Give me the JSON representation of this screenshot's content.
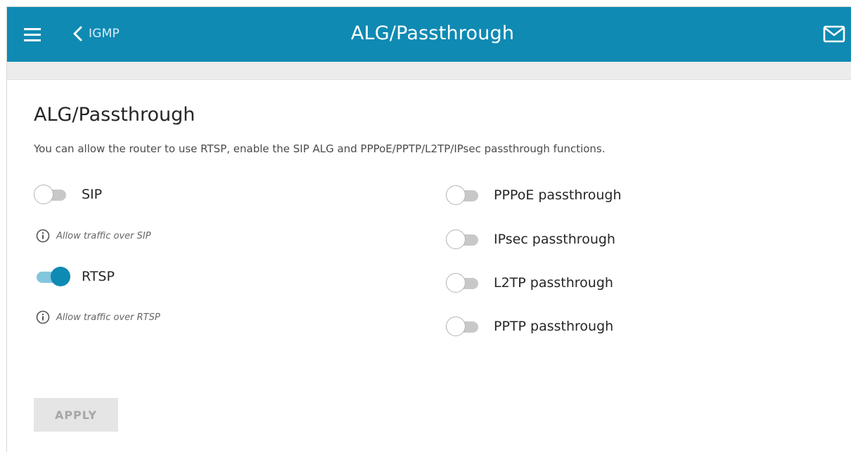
{
  "header": {
    "back_label": "IGMP",
    "title": "ALG/Passthrough",
    "menu_icon": "hamburger-menu-icon",
    "back_icon": "chevron-left-icon",
    "mail_icon": "envelope-icon",
    "background_color": "#0f8ab3"
  },
  "section": {
    "title": "ALG/Passthrough",
    "description": "You can allow the router to use RTSP, enable the SIP ALG and PPPoE/PPTP/L2TP/IPsec passthrough functions."
  },
  "left_toggles": [
    {
      "label": "SIP",
      "enabled": false,
      "hint": "Allow traffic over SIP",
      "hint_icon": "info-icon"
    },
    {
      "label": "RTSP",
      "enabled": true,
      "hint": "Allow traffic over RTSP",
      "hint_icon": "info-icon"
    }
  ],
  "right_toggles": [
    {
      "label": "PPPoE passthrough",
      "enabled": false
    },
    {
      "label": "IPsec passthrough",
      "enabled": false
    },
    {
      "label": "L2TP passthrough",
      "enabled": false
    },
    {
      "label": "PPTP passthrough",
      "enabled": false
    }
  ],
  "apply": {
    "label": "APPLY",
    "disabled": true
  },
  "colors": {
    "accent": "#0f8ab3",
    "toggle_on_track": "#82c6dd",
    "toggle_off_track": "#c8c8c8"
  }
}
